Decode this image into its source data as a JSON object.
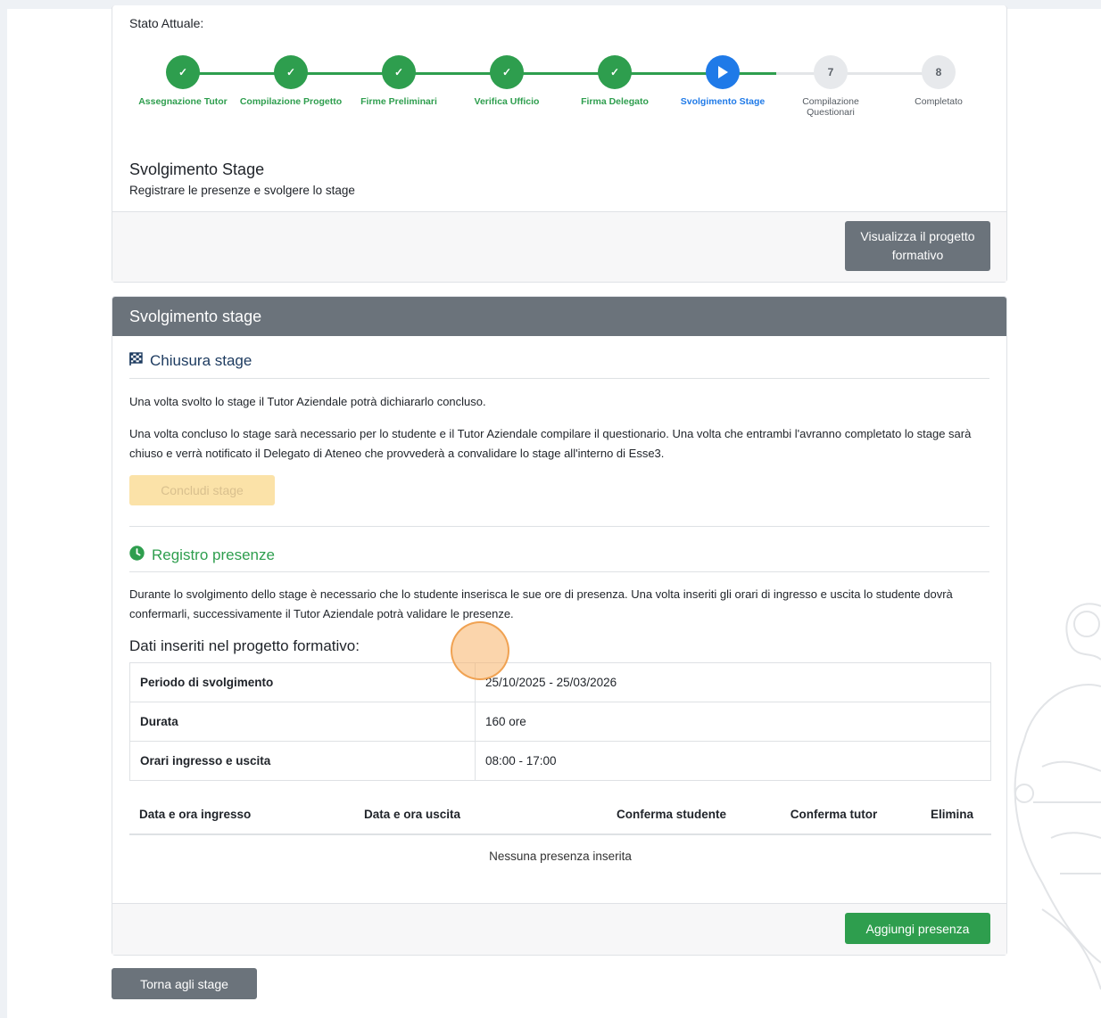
{
  "stato": {
    "label": "Stato Attuale:",
    "steps": [
      {
        "label": "Assegnazione Tutor",
        "status": "done"
      },
      {
        "label": "Compilazione Progetto",
        "status": "done"
      },
      {
        "label": "Firme Preliminari",
        "status": "done"
      },
      {
        "label": "Verifica Ufficio",
        "status": "done"
      },
      {
        "label": "Firma Delegato",
        "status": "done"
      },
      {
        "label": "Svolgimento Stage",
        "status": "active"
      },
      {
        "label": "Compilazione Questionari",
        "status": "todo",
        "number": "7"
      },
      {
        "label": "Completato",
        "status": "todo",
        "number": "8"
      }
    ],
    "current_title": "Svolgimento Stage",
    "current_desc": "Registrare le presenze e svolgere lo stage",
    "visualizza_button": "Visualizza il progetto formativo"
  },
  "svolgimento": {
    "header": "Svolgimento stage",
    "chiusura": {
      "title": "Chiusura stage",
      "para1": "Una volta svolto lo stage il Tutor Aziendale potrà dichiararlo concluso.",
      "para2": "Una volta concluso lo stage sarà necessario per lo studente e il Tutor Aziendale compilare il questionario. Una volta che entrambi l'avranno completato lo stage sarà chiuso e verrà notificato il Delegato di Ateneo che provvederà a convalidare lo stage all'interno di Esse3.",
      "button": "Concludi stage"
    },
    "registro": {
      "title": "Registro presenze",
      "para": "Durante lo svolgimento dello stage è necessario che lo studente inserisca le sue ore di presenza. Una volta inseriti gli orari di ingresso e uscita lo studente dovrà confermarli, successivamente il Tutor Aziendale potrà validare le presenze.",
      "dati_title": "Dati inseriti nel progetto formativo:",
      "dati": [
        {
          "key": "Periodo di svolgimento",
          "value": "25/10/2025 - 25/03/2026"
        },
        {
          "key": "Durata",
          "value": "160 ore"
        },
        {
          "key": "Orari ingresso e uscita",
          "value": "08:00 - 17:00"
        }
      ],
      "columns": [
        "Data e ora ingresso",
        "Data e ora uscita",
        "Conferma studente",
        "Conferma tutor",
        "Elimina"
      ],
      "empty": "Nessuna presenza inserita",
      "add_button": "Aggiungi presenza"
    }
  },
  "torna_button": "Torna agli stage",
  "colors": {
    "done": "#2e9e4e",
    "active": "#1f7ae8",
    "header": "#6b737b"
  }
}
